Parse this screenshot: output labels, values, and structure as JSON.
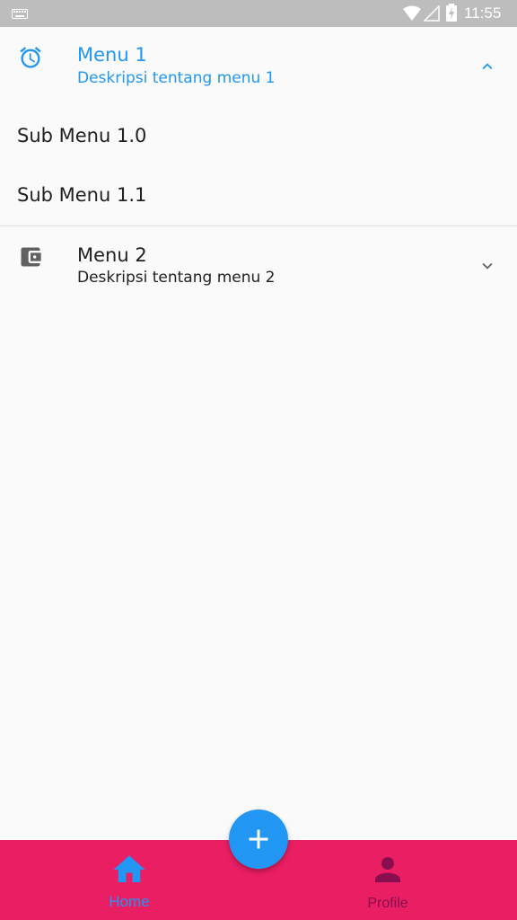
{
  "status_bar": {
    "time": "11:55",
    "icons": [
      "keyboard-icon",
      "wifi-icon",
      "signal-icon",
      "battery-charging-icon"
    ]
  },
  "menus": [
    {
      "title": "Menu 1",
      "subtitle": "Deskripsi tentang menu 1",
      "icon": "alarm-icon",
      "expanded": true,
      "items": [
        "Sub Menu 1.0",
        "Sub Menu 1.1"
      ]
    },
    {
      "title": "Menu 2",
      "subtitle": "Deskripsi tentang menu 2",
      "icon": "wallet-icon",
      "expanded": false
    }
  ],
  "bottom_nav": {
    "items": [
      {
        "label": "Home",
        "icon": "home-icon",
        "active": true
      },
      {
        "label": "Profile",
        "icon": "person-icon",
        "active": false
      }
    ]
  },
  "fab": {
    "icon": "add-icon"
  },
  "colors": {
    "accent": "#2196f3",
    "nav_background": "#e91e63",
    "nav_inactive": "#880e4f",
    "status_bar": "#bdbdbd",
    "background": "#fafafa",
    "text": "#212121"
  }
}
